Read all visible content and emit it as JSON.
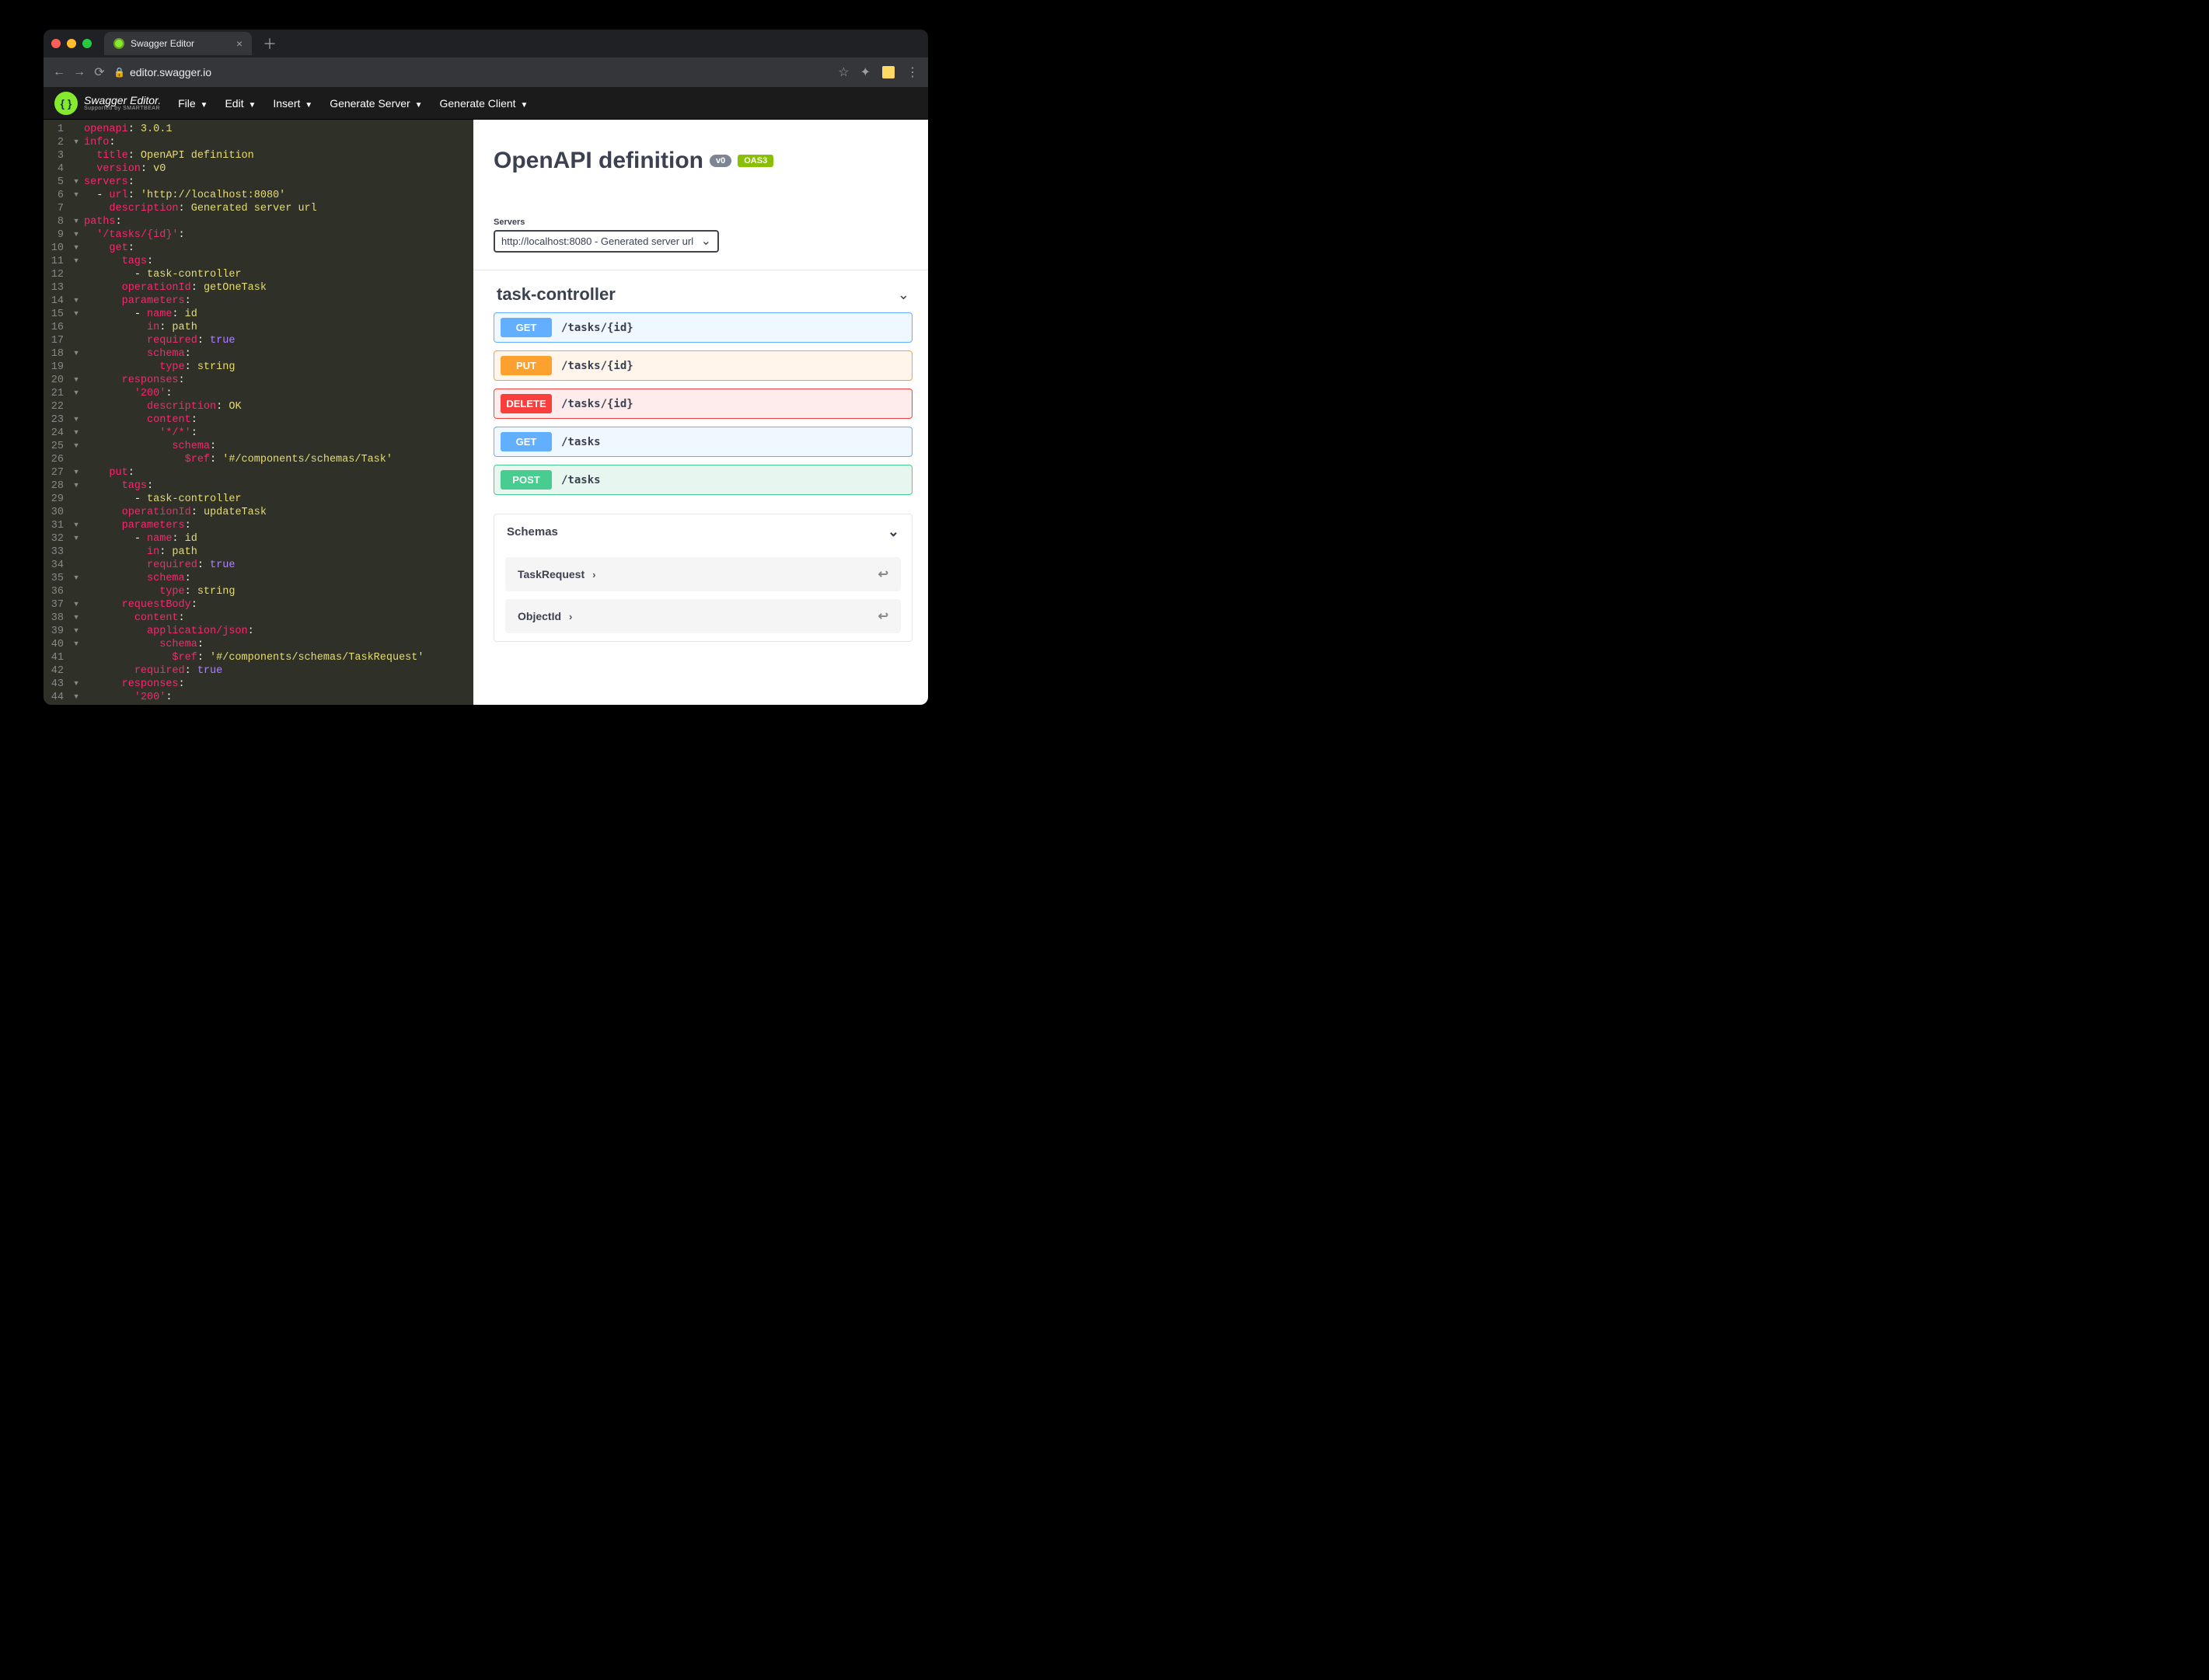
{
  "browser": {
    "tab_title": "Swagger Editor",
    "url_display": "editor.swagger.io"
  },
  "appbar": {
    "logo_title": "Swagger Editor.",
    "logo_sub": "Supported by SMARTBEAR",
    "menus": {
      "file": "File",
      "edit": "Edit",
      "insert": "Insert",
      "gen_server": "Generate Server",
      "gen_client": "Generate Client"
    }
  },
  "editor": {
    "lines": [
      {
        "n": "1",
        "fold": "",
        "tokens": [
          [
            "k-key",
            "openapi"
          ],
          [
            "k-plain",
            ": "
          ],
          [
            "k-str",
            "3.0.1"
          ]
        ]
      },
      {
        "n": "2",
        "fold": "▾",
        "tokens": [
          [
            "k-key",
            "info"
          ],
          [
            "k-plain",
            ":"
          ]
        ]
      },
      {
        "n": "3",
        "fold": "",
        "tokens": [
          [
            "k-plain",
            "  "
          ],
          [
            "k-key",
            "title"
          ],
          [
            "k-plain",
            ": "
          ],
          [
            "k-str",
            "OpenAPI definition"
          ]
        ]
      },
      {
        "n": "4",
        "fold": "",
        "tokens": [
          [
            "k-plain",
            "  "
          ],
          [
            "k-key",
            "version"
          ],
          [
            "k-plain",
            ": "
          ],
          [
            "k-str",
            "v0"
          ]
        ]
      },
      {
        "n": "5",
        "fold": "▾",
        "tokens": [
          [
            "k-key",
            "servers"
          ],
          [
            "k-plain",
            ":"
          ]
        ]
      },
      {
        "n": "6",
        "fold": "▾",
        "tokens": [
          [
            "k-plain",
            "  "
          ],
          [
            "k-dash",
            "- "
          ],
          [
            "k-key",
            "url"
          ],
          [
            "k-plain",
            ": "
          ],
          [
            "k-str",
            "'http://localhost:8080'"
          ]
        ]
      },
      {
        "n": "7",
        "fold": "",
        "tokens": [
          [
            "k-plain",
            "    "
          ],
          [
            "k-key",
            "description"
          ],
          [
            "k-plain",
            ": "
          ],
          [
            "k-str",
            "Generated server url"
          ]
        ]
      },
      {
        "n": "8",
        "fold": "▾",
        "tokens": [
          [
            "k-key",
            "paths"
          ],
          [
            "k-plain",
            ":"
          ]
        ]
      },
      {
        "n": "9",
        "fold": "▾",
        "tokens": [
          [
            "k-plain",
            "  "
          ],
          [
            "k-key",
            "'/tasks/{id}'"
          ],
          [
            "k-plain",
            ":"
          ]
        ]
      },
      {
        "n": "10",
        "fold": "▾",
        "tokens": [
          [
            "k-plain",
            "    "
          ],
          [
            "k-key",
            "get"
          ],
          [
            "k-plain",
            ":"
          ]
        ]
      },
      {
        "n": "11",
        "fold": "▾",
        "tokens": [
          [
            "k-plain",
            "      "
          ],
          [
            "k-key",
            "tags"
          ],
          [
            "k-plain",
            ":"
          ]
        ]
      },
      {
        "n": "12",
        "fold": "",
        "tokens": [
          [
            "k-plain",
            "        "
          ],
          [
            "k-dash",
            "- "
          ],
          [
            "k-str",
            "task-controller"
          ]
        ]
      },
      {
        "n": "13",
        "fold": "",
        "tokens": [
          [
            "k-plain",
            "      "
          ],
          [
            "k-key",
            "operationId"
          ],
          [
            "k-plain",
            ": "
          ],
          [
            "k-str",
            "getOneTask"
          ]
        ]
      },
      {
        "n": "14",
        "fold": "▾",
        "tokens": [
          [
            "k-plain",
            "      "
          ],
          [
            "k-key",
            "parameters"
          ],
          [
            "k-plain",
            ":"
          ]
        ]
      },
      {
        "n": "15",
        "fold": "▾",
        "tokens": [
          [
            "k-plain",
            "        "
          ],
          [
            "k-dash",
            "- "
          ],
          [
            "k-key",
            "name"
          ],
          [
            "k-plain",
            ": "
          ],
          [
            "k-str",
            "id"
          ]
        ]
      },
      {
        "n": "16",
        "fold": "",
        "tokens": [
          [
            "k-plain",
            "          "
          ],
          [
            "k-key",
            "in"
          ],
          [
            "k-plain",
            ": "
          ],
          [
            "k-str",
            "path"
          ]
        ]
      },
      {
        "n": "17",
        "fold": "",
        "tokens": [
          [
            "k-plain",
            "          "
          ],
          [
            "k-key",
            "required"
          ],
          [
            "k-plain",
            ": "
          ],
          [
            "k-bool",
            "true"
          ]
        ]
      },
      {
        "n": "18",
        "fold": "▾",
        "tokens": [
          [
            "k-plain",
            "          "
          ],
          [
            "k-key",
            "schema"
          ],
          [
            "k-plain",
            ":"
          ]
        ]
      },
      {
        "n": "19",
        "fold": "",
        "tokens": [
          [
            "k-plain",
            "            "
          ],
          [
            "k-key",
            "type"
          ],
          [
            "k-plain",
            ": "
          ],
          [
            "k-str",
            "string"
          ]
        ]
      },
      {
        "n": "20",
        "fold": "▾",
        "tokens": [
          [
            "k-plain",
            "      "
          ],
          [
            "k-key",
            "responses"
          ],
          [
            "k-plain",
            ":"
          ]
        ]
      },
      {
        "n": "21",
        "fold": "▾",
        "tokens": [
          [
            "k-plain",
            "        "
          ],
          [
            "k-key",
            "'200'"
          ],
          [
            "k-plain",
            ":"
          ]
        ]
      },
      {
        "n": "22",
        "fold": "",
        "tokens": [
          [
            "k-plain",
            "          "
          ],
          [
            "k-key",
            "description"
          ],
          [
            "k-plain",
            ": "
          ],
          [
            "k-str",
            "OK"
          ]
        ]
      },
      {
        "n": "23",
        "fold": "▾",
        "tokens": [
          [
            "k-plain",
            "          "
          ],
          [
            "k-key",
            "content"
          ],
          [
            "k-plain",
            ":"
          ]
        ]
      },
      {
        "n": "24",
        "fold": "▾",
        "tokens": [
          [
            "k-plain",
            "            "
          ],
          [
            "k-key",
            "'*/*'"
          ],
          [
            "k-plain",
            ":"
          ]
        ]
      },
      {
        "n": "25",
        "fold": "▾",
        "tokens": [
          [
            "k-plain",
            "              "
          ],
          [
            "k-key",
            "schema"
          ],
          [
            "k-plain",
            ":"
          ]
        ]
      },
      {
        "n": "26",
        "fold": "",
        "tokens": [
          [
            "k-plain",
            "                "
          ],
          [
            "k-key",
            "$ref"
          ],
          [
            "k-plain",
            ": "
          ],
          [
            "k-str",
            "'#/components/schemas/Task'"
          ]
        ]
      },
      {
        "n": "27",
        "fold": "▾",
        "tokens": [
          [
            "k-plain",
            "    "
          ],
          [
            "k-key",
            "put"
          ],
          [
            "k-plain",
            ":"
          ]
        ]
      },
      {
        "n": "28",
        "fold": "▾",
        "tokens": [
          [
            "k-plain",
            "      "
          ],
          [
            "k-key",
            "tags"
          ],
          [
            "k-plain",
            ":"
          ]
        ]
      },
      {
        "n": "29",
        "fold": "",
        "tokens": [
          [
            "k-plain",
            "        "
          ],
          [
            "k-dash",
            "- "
          ],
          [
            "k-str",
            "task-controller"
          ]
        ]
      },
      {
        "n": "30",
        "fold": "",
        "tokens": [
          [
            "k-plain",
            "      "
          ],
          [
            "k-key",
            "operationId"
          ],
          [
            "k-plain",
            ": "
          ],
          [
            "k-str",
            "updateTask"
          ]
        ]
      },
      {
        "n": "31",
        "fold": "▾",
        "tokens": [
          [
            "k-plain",
            "      "
          ],
          [
            "k-key",
            "parameters"
          ],
          [
            "k-plain",
            ":"
          ]
        ]
      },
      {
        "n": "32",
        "fold": "▾",
        "tokens": [
          [
            "k-plain",
            "        "
          ],
          [
            "k-dash",
            "- "
          ],
          [
            "k-key",
            "name"
          ],
          [
            "k-plain",
            ": "
          ],
          [
            "k-str",
            "id"
          ]
        ]
      },
      {
        "n": "33",
        "fold": "",
        "tokens": [
          [
            "k-plain",
            "          "
          ],
          [
            "k-key",
            "in"
          ],
          [
            "k-plain",
            ": "
          ],
          [
            "k-str",
            "path"
          ]
        ]
      },
      {
        "n": "34",
        "fold": "",
        "tokens": [
          [
            "k-plain",
            "          "
          ],
          [
            "k-key",
            "required"
          ],
          [
            "k-plain",
            ": "
          ],
          [
            "k-bool",
            "true"
          ]
        ]
      },
      {
        "n": "35",
        "fold": "▾",
        "tokens": [
          [
            "k-plain",
            "          "
          ],
          [
            "k-key",
            "schema"
          ],
          [
            "k-plain",
            ":"
          ]
        ]
      },
      {
        "n": "36",
        "fold": "",
        "tokens": [
          [
            "k-plain",
            "            "
          ],
          [
            "k-key",
            "type"
          ],
          [
            "k-plain",
            ": "
          ],
          [
            "k-str",
            "string"
          ]
        ]
      },
      {
        "n": "37",
        "fold": "▾",
        "tokens": [
          [
            "k-plain",
            "      "
          ],
          [
            "k-key",
            "requestBody"
          ],
          [
            "k-plain",
            ":"
          ]
        ]
      },
      {
        "n": "38",
        "fold": "▾",
        "tokens": [
          [
            "k-plain",
            "        "
          ],
          [
            "k-key",
            "content"
          ],
          [
            "k-plain",
            ":"
          ]
        ]
      },
      {
        "n": "39",
        "fold": "▾",
        "tokens": [
          [
            "k-plain",
            "          "
          ],
          [
            "k-key",
            "application/json"
          ],
          [
            "k-plain",
            ":"
          ]
        ]
      },
      {
        "n": "40",
        "fold": "▾",
        "tokens": [
          [
            "k-plain",
            "            "
          ],
          [
            "k-key",
            "schema"
          ],
          [
            "k-plain",
            ":"
          ]
        ]
      },
      {
        "n": "41",
        "fold": "",
        "tokens": [
          [
            "k-plain",
            "              "
          ],
          [
            "k-key",
            "$ref"
          ],
          [
            "k-plain",
            ": "
          ],
          [
            "k-str",
            "'#/components/schemas/TaskRequest'"
          ]
        ]
      },
      {
        "n": "42",
        "fold": "",
        "tokens": [
          [
            "k-plain",
            "        "
          ],
          [
            "k-key",
            "required"
          ],
          [
            "k-plain",
            ": "
          ],
          [
            "k-bool",
            "true"
          ]
        ]
      },
      {
        "n": "43",
        "fold": "▾",
        "tokens": [
          [
            "k-plain",
            "      "
          ],
          [
            "k-key",
            "responses"
          ],
          [
            "k-plain",
            ":"
          ]
        ]
      },
      {
        "n": "44",
        "fold": "▾",
        "tokens": [
          [
            "k-plain",
            "        "
          ],
          [
            "k-key",
            "'200'"
          ],
          [
            "k-plain",
            ":"
          ]
        ]
      }
    ]
  },
  "swagger": {
    "title": "OpenAPI definition",
    "version_badge": "v0",
    "oas_badge": "OAS3",
    "servers_label": "Servers",
    "server_selected": "http://localhost:8080 - Generated server url",
    "tag": "task-controller",
    "ops": [
      {
        "method": "GET",
        "path": "/tasks/{id}",
        "cls": "get"
      },
      {
        "method": "PUT",
        "path": "/tasks/{id}",
        "cls": "put"
      },
      {
        "method": "DELETE",
        "path": "/tasks/{id}",
        "cls": "delete"
      },
      {
        "method": "GET",
        "path": "/tasks",
        "cls": "get"
      },
      {
        "method": "POST",
        "path": "/tasks",
        "cls": "post"
      }
    ],
    "schemas_label": "Schemas",
    "schemas": [
      {
        "name": "TaskRequest"
      },
      {
        "name": "ObjectId"
      }
    ]
  }
}
